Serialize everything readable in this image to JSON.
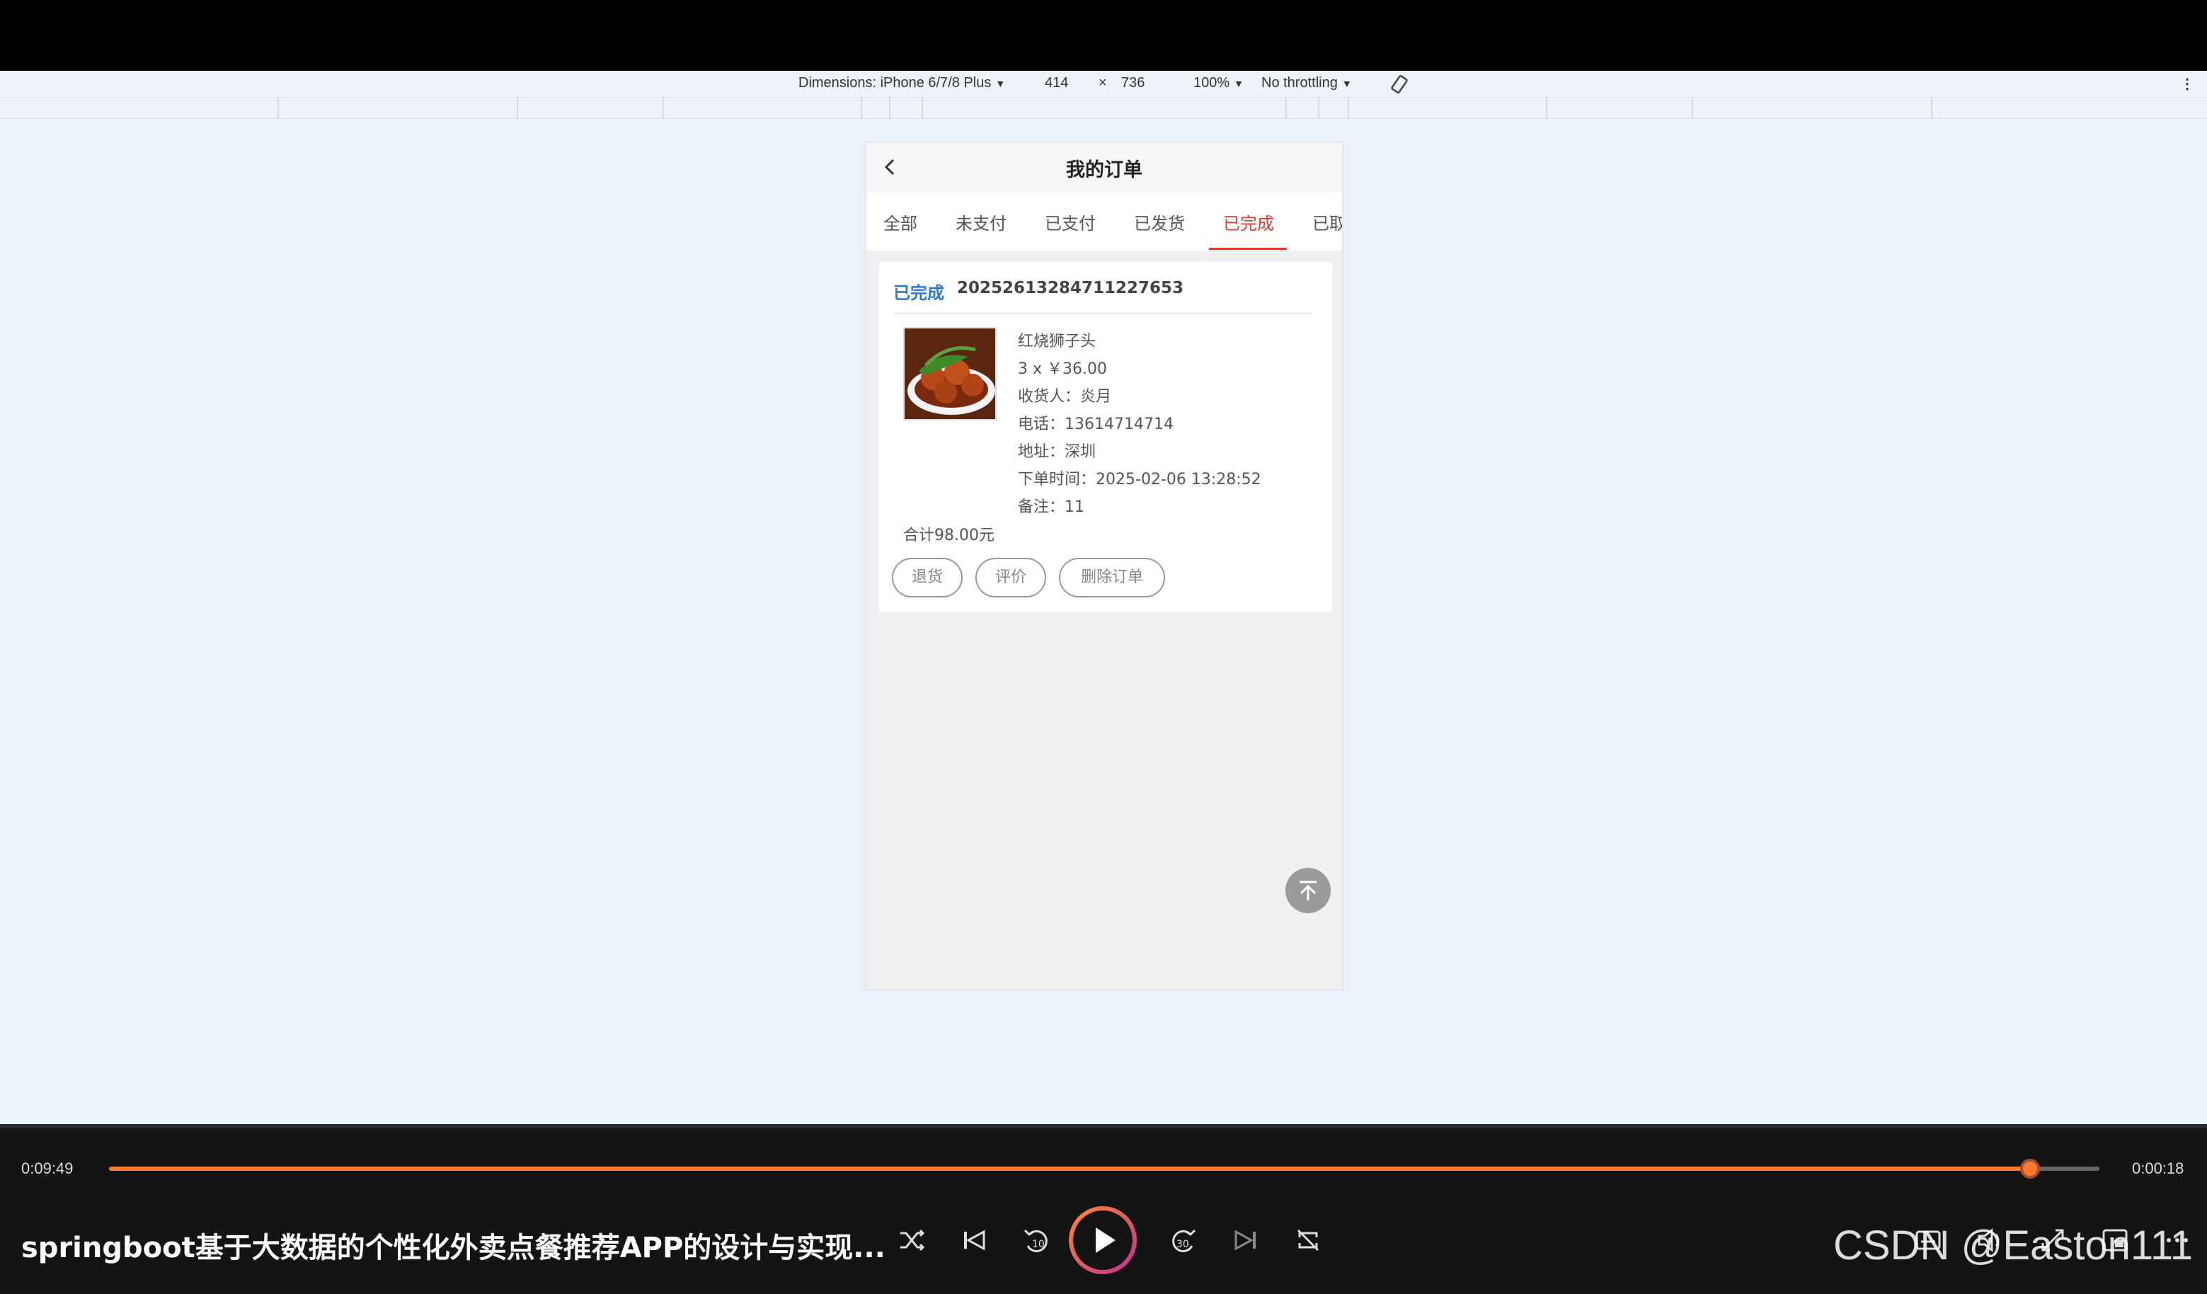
{
  "devtools": {
    "dimensions_label": "Dimensions: iPhone 6/7/8 Plus",
    "width": "414",
    "times": "×",
    "height": "736",
    "zoom": "100%",
    "throttling": "No throttling"
  },
  "app": {
    "title": "我的订单",
    "tabs": [
      {
        "label": "全部",
        "active": false
      },
      {
        "label": "未支付",
        "active": false
      },
      {
        "label": "已支付",
        "active": false
      },
      {
        "label": "已发货",
        "active": false
      },
      {
        "label": "已完成",
        "active": true
      },
      {
        "label": "已取",
        "active": false
      }
    ],
    "order": {
      "status": "已完成",
      "order_no": "20252613284711227653",
      "item_name": "红烧狮子头",
      "qty_price": "3 x ￥36.00",
      "receiver_label": "收货人：",
      "receiver": "炎月",
      "phone_label": "电话：",
      "phone": "13614714714",
      "address_label": "地址：",
      "address": "深圳",
      "order_time_label": "下单时间：",
      "order_time": "2025-02-06 13:28:52",
      "note_label": "备注：",
      "note": "11",
      "total": "合计98.00元",
      "buttons": {
        "return": "退货",
        "review": "评价",
        "delete": "删除订单"
      }
    }
  },
  "player": {
    "current_time": "0:09:49",
    "remaining_time": "0:00:18",
    "progress_fraction": 0.965,
    "video_title": "springboot基于大数据的个性化外卖点餐推荐APP的设计与实现...",
    "watermark": "CSDN @Easton111",
    "accent_color": "#ff7a2e"
  }
}
